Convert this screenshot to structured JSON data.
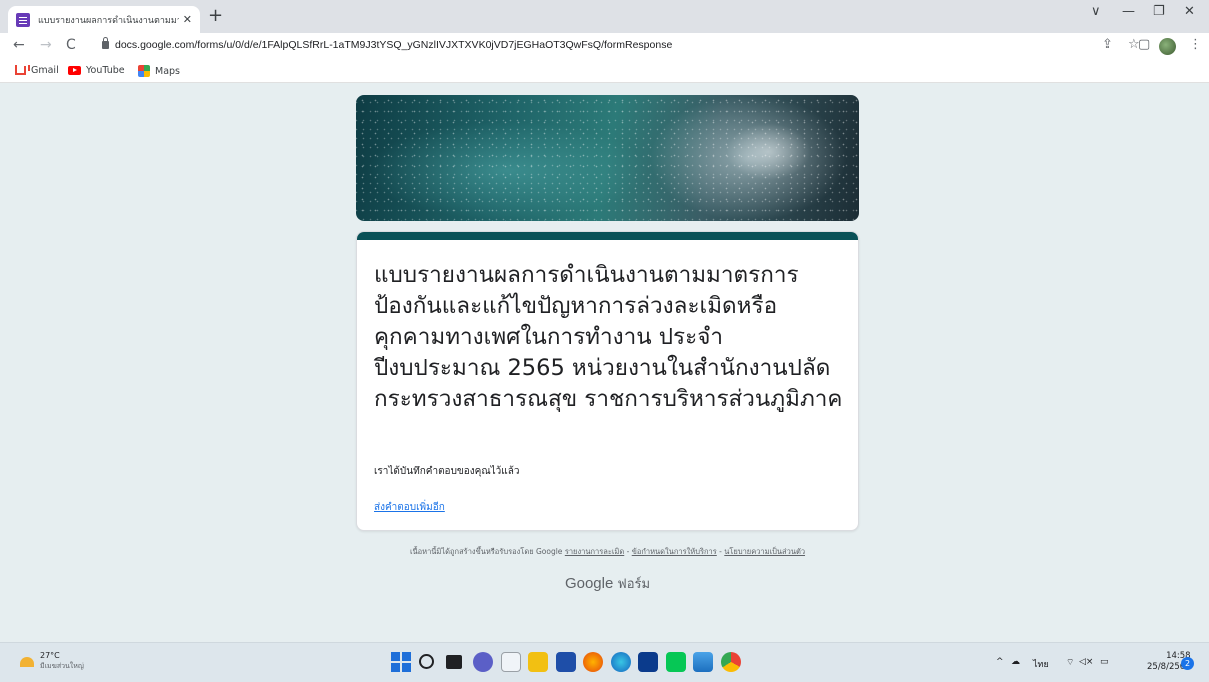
{
  "browser": {
    "tab_title": "แบบรายงานผลการดำเนินงานตามมาต",
    "tab_close": "✕",
    "new_tab": "+",
    "url": "docs.google.com/forms/u/0/d/e/1FAlpQLSfRrL-1aTM9J3tYSQ_yGNzlIVJXTXVK0jVD7jEGHaOT3QwFsQ/formResponse",
    "back": "←",
    "forward": "→",
    "reload": "C",
    "share": "⇪",
    "star": "☆",
    "side_panel": "▢",
    "menu": "⋮",
    "window_controls": {
      "chevron": "∨",
      "minimize": "—",
      "restore": "❐",
      "close": "✕"
    }
  },
  "bookmarks": [
    {
      "label": "Gmail",
      "icon": "gmail-icon"
    },
    {
      "label": "YouTube",
      "icon": "youtube-icon"
    },
    {
      "label": "Maps",
      "icon": "maps-icon"
    }
  ],
  "form": {
    "title": "แบบรายงานผลการดำเนินงานตามมาตรการป้องกันและแก้ไขปัญหาการล่วงละเมิดหรือคุกคามทางเพศในการทำงาน ประจำปีงบประมาณ 2565 หน่วยงานในสำนักงานปลัดกระทรวงสาธารณสุข ราชการบริหารส่วนภูมิภาค",
    "confirmation": "เราได้บันทึกคำตอบของคุณไว้แล้ว",
    "submit_another": "ส่งคำตอบเพิ่มอีก",
    "accent_color": "#0a5157"
  },
  "footer": {
    "notice": "เนื้อหานี้มิได้ถูกสร้างขึ้นหรือรับรองโดย Google",
    "report": "รายงานการละเมิด",
    "terms": "ข้อกำหนดในการให้บริการ",
    "privacy": "นโยบายความเป็นส่วนตัว",
    "sep": " - ",
    "brand": "Google",
    "brand_sub": "ฟอร์ม"
  },
  "taskbar": {
    "weather_temp": "27°C",
    "weather_desc": "มีเมฆส่วนใหญ่",
    "tray_chevron": "^",
    "language": "ไทย",
    "time": "14:58",
    "date": "25/8/2565",
    "notifications": "2"
  }
}
